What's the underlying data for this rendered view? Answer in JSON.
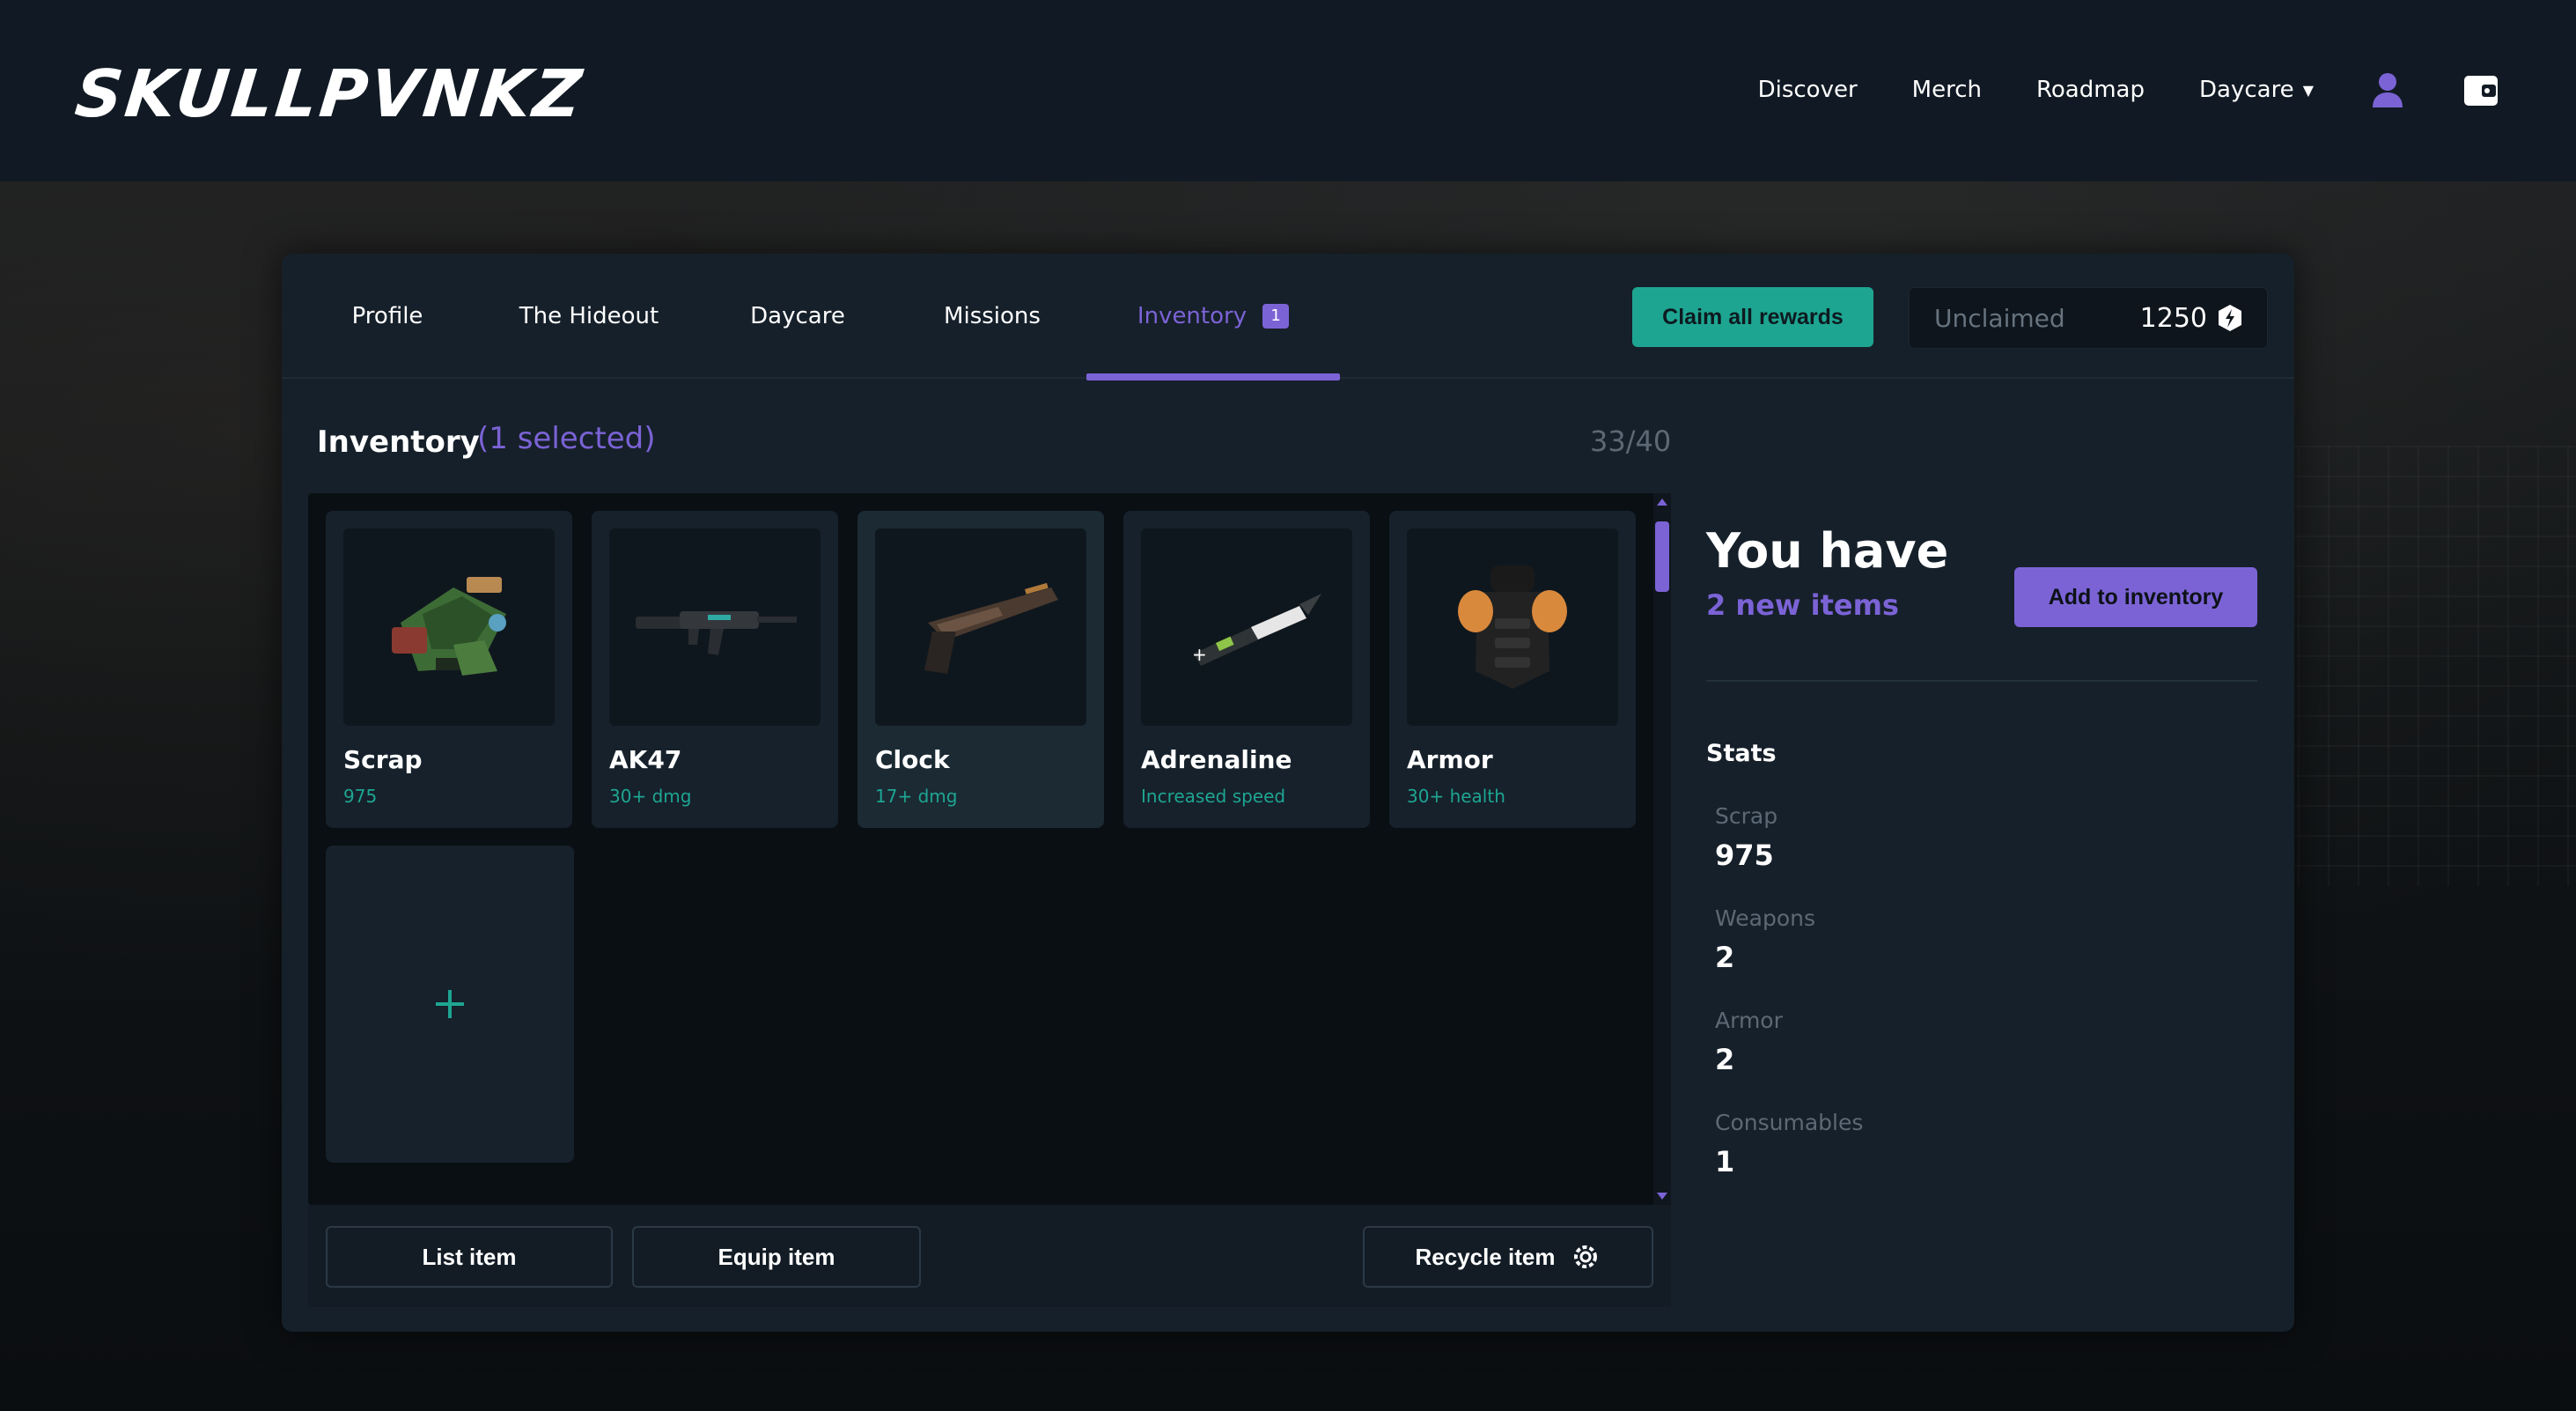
{
  "brand": {
    "logo_text": "SKULLPVNKZ"
  },
  "nav": {
    "links": [
      "Discover",
      "Merch",
      "Roadmap",
      "Daycare"
    ],
    "icons": [
      "user-icon",
      "wallet-icon"
    ]
  },
  "tabs": [
    {
      "label": "Profile"
    },
    {
      "label": "The Hideout"
    },
    {
      "label": "Daycare"
    },
    {
      "label": "Missions"
    },
    {
      "label": "Inventory",
      "badge": "1",
      "active": true
    }
  ],
  "rewards": {
    "claim_label": "Claim all rewards",
    "unclaimed_label": "Unclaimed",
    "unclaimed_value": "1250"
  },
  "inventory": {
    "title": "Inventory",
    "selected": "(1 selected)",
    "count": "33/40",
    "items": [
      {
        "name": "Scrap",
        "sub": "975",
        "icon": "scrap-icon"
      },
      {
        "name": "AK47",
        "sub": "30+ dmg",
        "icon": "rifle-icon"
      },
      {
        "name": "Clock",
        "sub": "17+ dmg",
        "icon": "pistol-icon",
        "selected": true
      },
      {
        "name": "Adrenaline",
        "sub": "Increased speed",
        "icon": "syringe-icon"
      },
      {
        "name": "Armor",
        "sub": "30+ health",
        "icon": "armor-icon"
      }
    ],
    "add_icon": "plus-icon"
  },
  "actions": {
    "list_label": "List item",
    "equip_label": "Equip item",
    "recycle_label": "Recycle item"
  },
  "summary": {
    "heading": "You have",
    "new_items": "2 new items",
    "add_label": "Add to inventory"
  },
  "stats": {
    "title": "Stats",
    "rows": [
      {
        "label": "Scrap",
        "value": "975"
      },
      {
        "label": "Weapons",
        "value": "2"
      },
      {
        "label": "Armor",
        "value": "2"
      },
      {
        "label": "Consumables",
        "value": "1"
      }
    ]
  },
  "colors": {
    "accent": "#7b63d6",
    "teal": "#1ea592",
    "panel": "#16202a",
    "background": "#0c1117"
  }
}
